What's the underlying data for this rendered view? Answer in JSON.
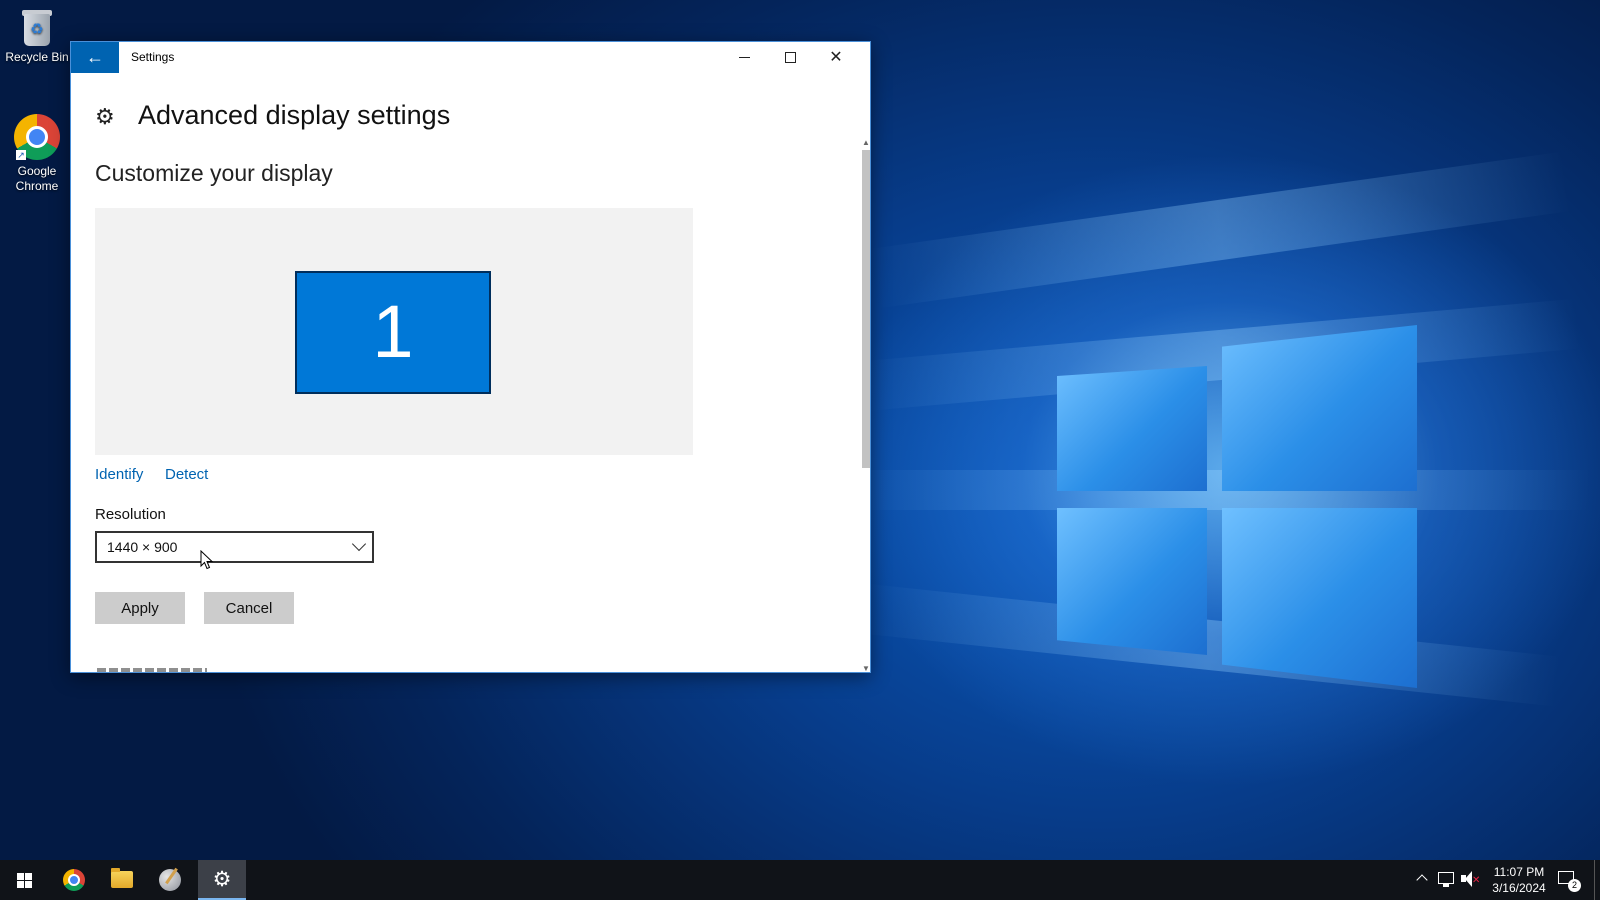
{
  "desktop": {
    "icons": [
      {
        "label": "Recycle Bin",
        "icon": "recycle-bin-icon"
      },
      {
        "label": "Google\nChrome",
        "icon": "chrome-icon"
      }
    ]
  },
  "window": {
    "title": "Settings",
    "back_icon": "back-arrow-icon",
    "caption_buttons": [
      "minimize",
      "maximize",
      "close"
    ]
  },
  "page": {
    "title": "Advanced display settings",
    "icon": "gear-icon",
    "section_title": "Customize your display",
    "monitor_number": "1",
    "links": {
      "identify": "Identify",
      "detect": "Detect"
    },
    "resolution": {
      "label": "Resolution",
      "value": "1440 × 900"
    },
    "buttons": {
      "apply": "Apply",
      "cancel": "Cancel"
    }
  },
  "taskbar": {
    "pinned": [
      "start-icon",
      "chrome-icon",
      "file-explorer-icon",
      "paint-icon",
      "settings-icon"
    ],
    "active": "settings-icon",
    "clock": {
      "time": "11:07 PM",
      "date": "3/16/2024"
    },
    "notification_count": "2"
  },
  "colors": {
    "accent": "#0078d7",
    "link": "#0063b1",
    "back_button": "#0063b1",
    "taskbar": "#101318"
  }
}
